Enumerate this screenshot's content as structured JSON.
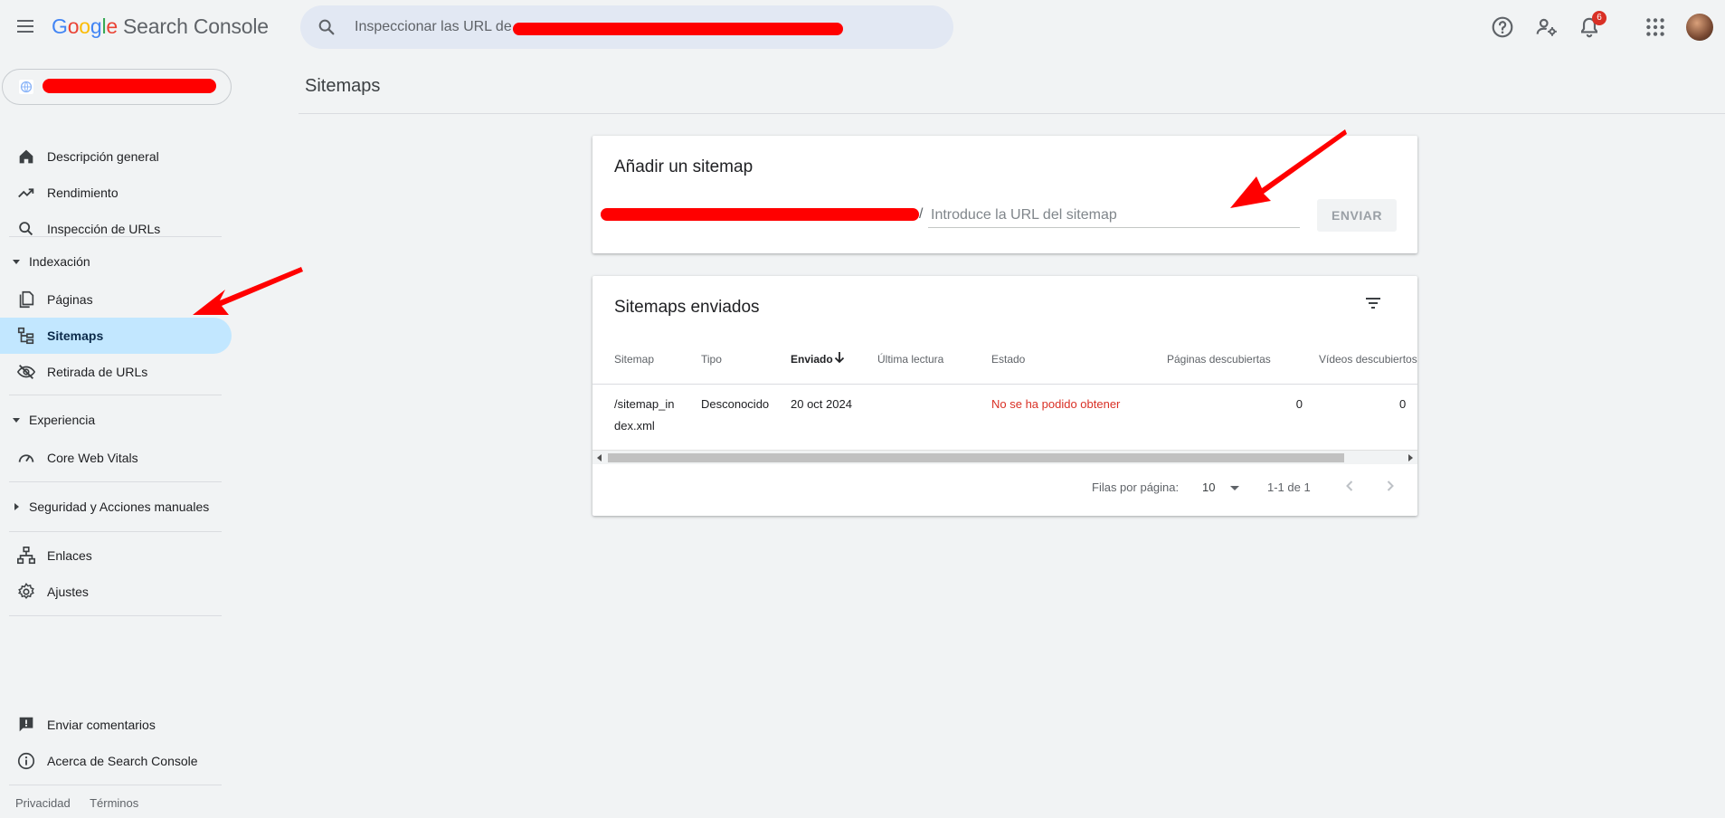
{
  "header": {
    "product_name": "Search Console",
    "logo_letters": [
      "G",
      "o",
      "o",
      "g",
      "l",
      "e"
    ],
    "search_placeholder": "Inspeccionar las URL de",
    "notifications_count": "6"
  },
  "sidebar": {
    "nav": [
      {
        "label": "Descripción general",
        "icon": "home-icon"
      },
      {
        "label": "Rendimiento",
        "icon": "trending-up-icon"
      },
      {
        "label": "Inspección de URLs",
        "icon": "search-icon"
      }
    ],
    "sections": [
      {
        "title": "Indexación",
        "expanded": true,
        "items": [
          {
            "label": "Páginas",
            "icon": "pages-icon"
          },
          {
            "label": "Sitemaps",
            "icon": "sitemap-icon",
            "active": true
          },
          {
            "label": "Retirada de URLs",
            "icon": "eye-off-icon"
          }
        ]
      },
      {
        "title": "Experiencia",
        "expanded": true,
        "items": [
          {
            "label": "Core Web Vitals",
            "icon": "gauge-icon"
          }
        ]
      },
      {
        "title": "Seguridad y Acciones manuales",
        "expanded": false,
        "items": []
      }
    ],
    "bottom_nav": [
      {
        "label": "Enlaces",
        "icon": "links-icon"
      },
      {
        "label": "Ajustes",
        "icon": "gear-icon"
      }
    ],
    "footer_nav": [
      {
        "label": "Enviar comentarios",
        "icon": "feedback-icon"
      },
      {
        "label": "Acerca de Search Console",
        "icon": "info-icon"
      }
    ],
    "footer_links": [
      "Privacidad",
      "Términos"
    ]
  },
  "main": {
    "page_title": "Sitemaps",
    "add_card": {
      "title": "Añadir un sitemap",
      "input_placeholder": "Introduce la URL del sitemap",
      "prefix_separator": "/",
      "submit_label": "ENVIAR"
    },
    "submitted_card": {
      "title": "Sitemaps enviados",
      "columns": [
        "Sitemap",
        "Tipo",
        "Enviado",
        "Última lectura",
        "Estado",
        "Páginas descubiertas",
        "Vídeos descubiertos"
      ],
      "sorted_column": "Enviado",
      "rows": [
        {
          "sitemap_line1": "/sitemap_in",
          "sitemap_line2": "dex.xml",
          "tipo": "Desconocido",
          "enviado": "20 oct 2024",
          "ultima_lectura": "",
          "estado": "No se ha podido obtener",
          "paginas": "0",
          "videos": "0"
        }
      ],
      "pagination": {
        "rows_per_page_label": "Filas por página:",
        "rows_per_page": "10",
        "range": "1-1 de 1"
      }
    }
  },
  "colors": {
    "accent_active": "#c2e7ff",
    "error": "#d93025",
    "annotation": "#ff0000"
  }
}
